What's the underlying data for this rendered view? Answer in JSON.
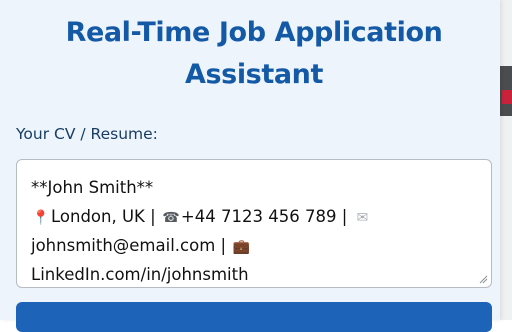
{
  "header": {
    "title_line1": "Real-Time Job Application",
    "title_line2": "Assistant"
  },
  "cv_field": {
    "label": "Your CV / Resume:",
    "lines": [
      "**John Smith**",
      "London, UK | ",
      "+44 7123 456 789 | ",
      "johnsmith@email.com | ",
      "LinkedIn.com/in/johnsmith"
    ],
    "icons": [
      "location-pin-icon",
      "phone-icon",
      "envelope-icon",
      "briefcase-icon"
    ]
  },
  "colors": {
    "title": "#1359a6",
    "label": "#173d63",
    "panel_bg": "#eef4fc",
    "button_bg": "#1d63b8"
  }
}
